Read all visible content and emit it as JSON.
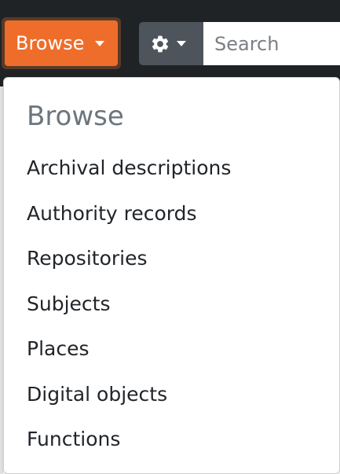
{
  "toolbar": {
    "browse_label": "Browse",
    "gear_icon": "gear-icon",
    "search_placeholder": "Search"
  },
  "colors": {
    "topbar_bg": "#202326",
    "browse_orange": "#ee6d2a",
    "gear_button_bg": "#4d545c",
    "header_gray": "#6c757d",
    "item_text": "#212529"
  },
  "dropdown": {
    "header": "Browse",
    "items": [
      {
        "label": "Archival descriptions"
      },
      {
        "label": "Authority records"
      },
      {
        "label": "Repositories"
      },
      {
        "label": "Subjects"
      },
      {
        "label": "Places"
      },
      {
        "label": "Digital objects"
      },
      {
        "label": "Functions"
      }
    ]
  }
}
